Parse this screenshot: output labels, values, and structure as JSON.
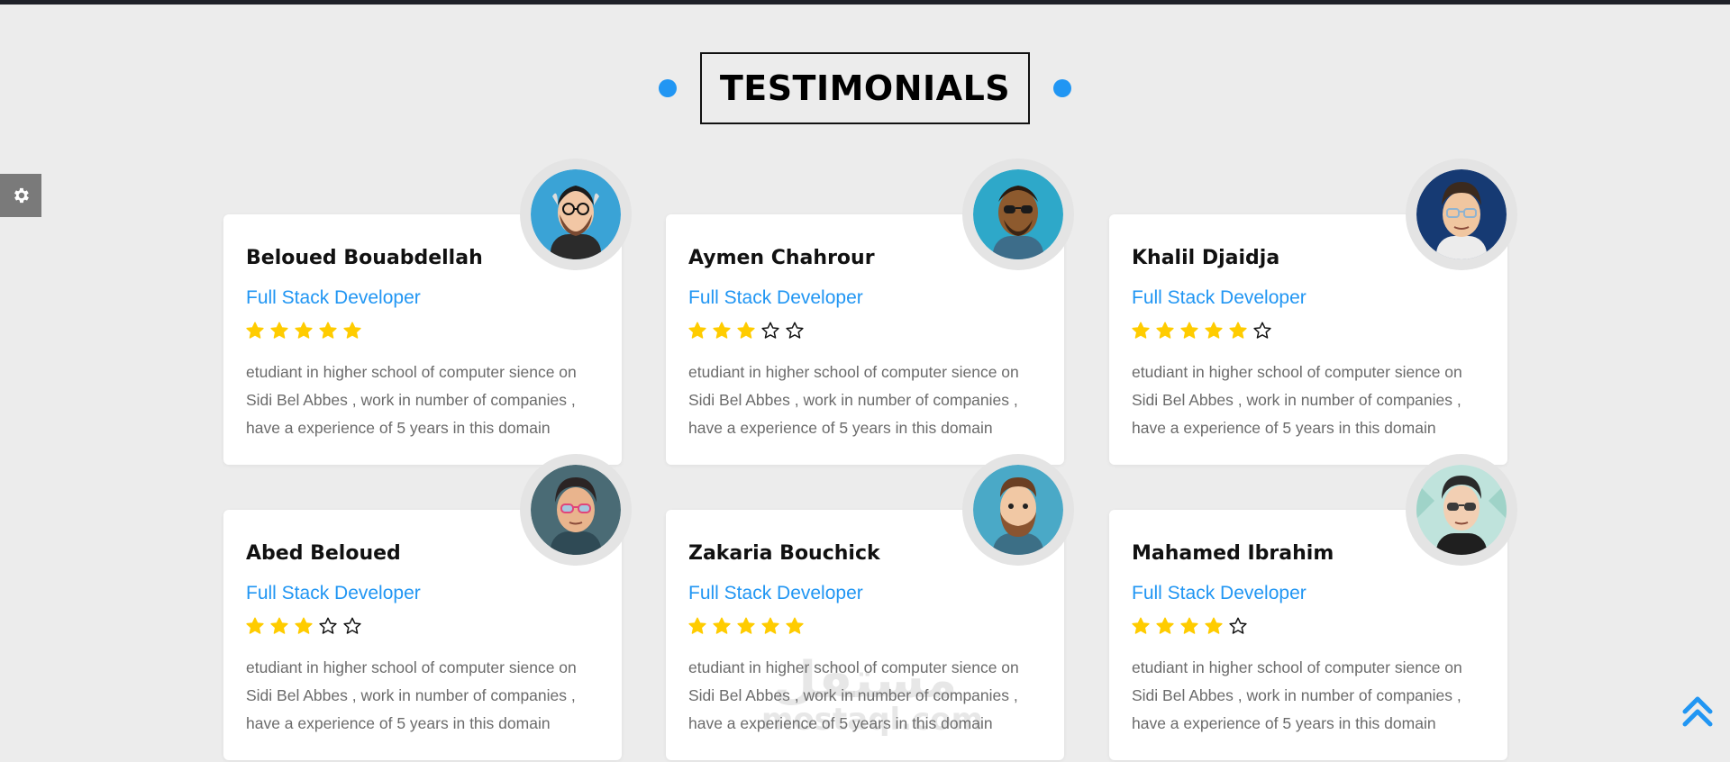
{
  "section": {
    "title": "TESTIMONIALS",
    "accent_color": "#2196f3"
  },
  "settings": {
    "icon": "gear-icon"
  },
  "back_to_top": {
    "icon": "double-chevron-up-icon"
  },
  "watermark": {
    "arabic": "مستقل",
    "latin": "mostaql.com"
  },
  "testimonials": [
    {
      "name": "Beloued Bouabdellah",
      "role": "Full Stack Developer",
      "rating": 5,
      "max_rating": 5,
      "bio": "etudiant in higher school of computer sience on Sidi Bel Abbes , work in number of companies , have a experience of 5 years in this domain",
      "avatar": "bearded-man-glasses-avatar"
    },
    {
      "name": "Aymen Chahrour",
      "role": "Full Stack Developer",
      "rating": 3,
      "max_rating": 5,
      "bio": "etudiant in higher school of computer sience on Sidi Bel Abbes , work in number of companies , have a experience of 5 years in this domain",
      "avatar": "man-sunglasses-avatar"
    },
    {
      "name": "Khalil Djaidja",
      "role": "Full Stack Developer",
      "rating": 5,
      "max_rating": 6,
      "bio": "etudiant in higher school of computer sience on Sidi Bel Abbes , work in number of companies , have a experience of 5 years in this domain",
      "avatar": "man-glasses-avatar"
    },
    {
      "name": "Abed Beloued",
      "role": "Full Stack Developer",
      "rating": 3,
      "max_rating": 5,
      "bio": "etudiant in higher school of computer sience on Sidi Bel Abbes , work in number of companies , have a experience of 5 years in this domain",
      "avatar": "man-pink-glasses-avatar"
    },
    {
      "name": "Zakaria Bouchick",
      "role": "Full Stack Developer",
      "rating": 5,
      "max_rating": 5,
      "bio": "etudiant in higher school of computer sience on Sidi Bel Abbes , work in number of companies , have a experience of 5 years in this domain",
      "avatar": "bearded-man-avatar"
    },
    {
      "name": "Mahamed Ibrahim",
      "role": "Full Stack Developer",
      "rating": 4,
      "max_rating": 5,
      "bio": "etudiant in higher school of computer sience on Sidi Bel Abbes , work in number of companies , have a experience of 5 years in this domain",
      "avatar": "man-aviator-glasses-avatar"
    }
  ]
}
